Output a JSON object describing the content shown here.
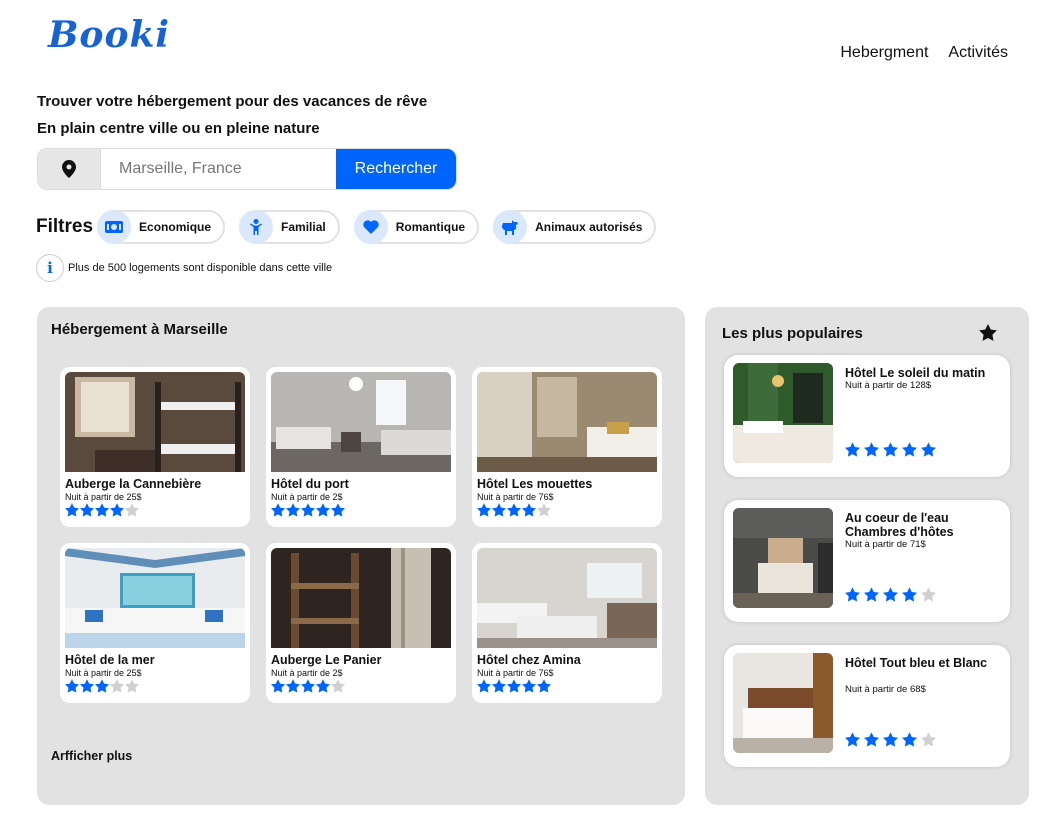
{
  "brand": {
    "logo_text": "Booki",
    "color": "#1762d4"
  },
  "nav": {
    "items": [
      "Hebergment",
      "Activités"
    ]
  },
  "hero": {
    "headline": "Trouver votre hébergement pour des vacances de rêve",
    "subheadline": "En plain centre ville ou en pleine nature"
  },
  "search": {
    "icon": "map-pin-icon",
    "placeholder": "Marseille, France",
    "button_label": "Rechercher",
    "accent": "#0065fc"
  },
  "filters": {
    "title": "Filtres",
    "items": [
      {
        "label": "Economique",
        "icon": "money-icon"
      },
      {
        "label": "Familial",
        "icon": "child-icon"
      },
      {
        "label": "Romantique",
        "icon": "heart-icon"
      },
      {
        "label": "Animaux autorisés",
        "icon": "dog-icon"
      }
    ]
  },
  "info": {
    "icon": "info-icon",
    "text": "Plus de 500 logements sont disponible dans cette ville"
  },
  "listings": {
    "title": "Hébergement à Marseille",
    "show_more": "Arfficher plus",
    "items": [
      {
        "name": "Auberge la Cannebière",
        "price": "Nuit à partir de 25$",
        "rating": 4
      },
      {
        "name": "Hôtel du port",
        "price": "Nuit à partir de 2$",
        "rating": 5
      },
      {
        "name": "Hôtel Les mouettes",
        "price": "Nuit à partir de 76$",
        "rating": 4
      },
      {
        "name": "Hôtel de la mer",
        "price": "Nuit à partir de 25$",
        "rating": 3
      },
      {
        "name": "Auberge Le Panier",
        "price": "Nuit à partir de 2$",
        "rating": 4
      },
      {
        "name": "Hôtel chez Amina",
        "price": "Nuit à partir de 76$",
        "rating": 5
      }
    ]
  },
  "popular": {
    "title": "Les plus populaires",
    "icon": "star-icon",
    "items": [
      {
        "name": "Hôtel Le soleil du matin",
        "price": "Nuit à partir de 128$",
        "rating": 5
      },
      {
        "name": "Au coeur de l'eau Chambres d'hôtes",
        "price": "Nuit à partir de 71$",
        "rating": 4
      },
      {
        "name": "Hôtel Tout bleu et Blanc",
        "price": "Nuit à partir de 68$",
        "rating": 4
      }
    ]
  },
  "colors": {
    "star_on": "#0065fc",
    "star_off": "#d0d0d0",
    "panel_bg": "#e2e2e2"
  }
}
